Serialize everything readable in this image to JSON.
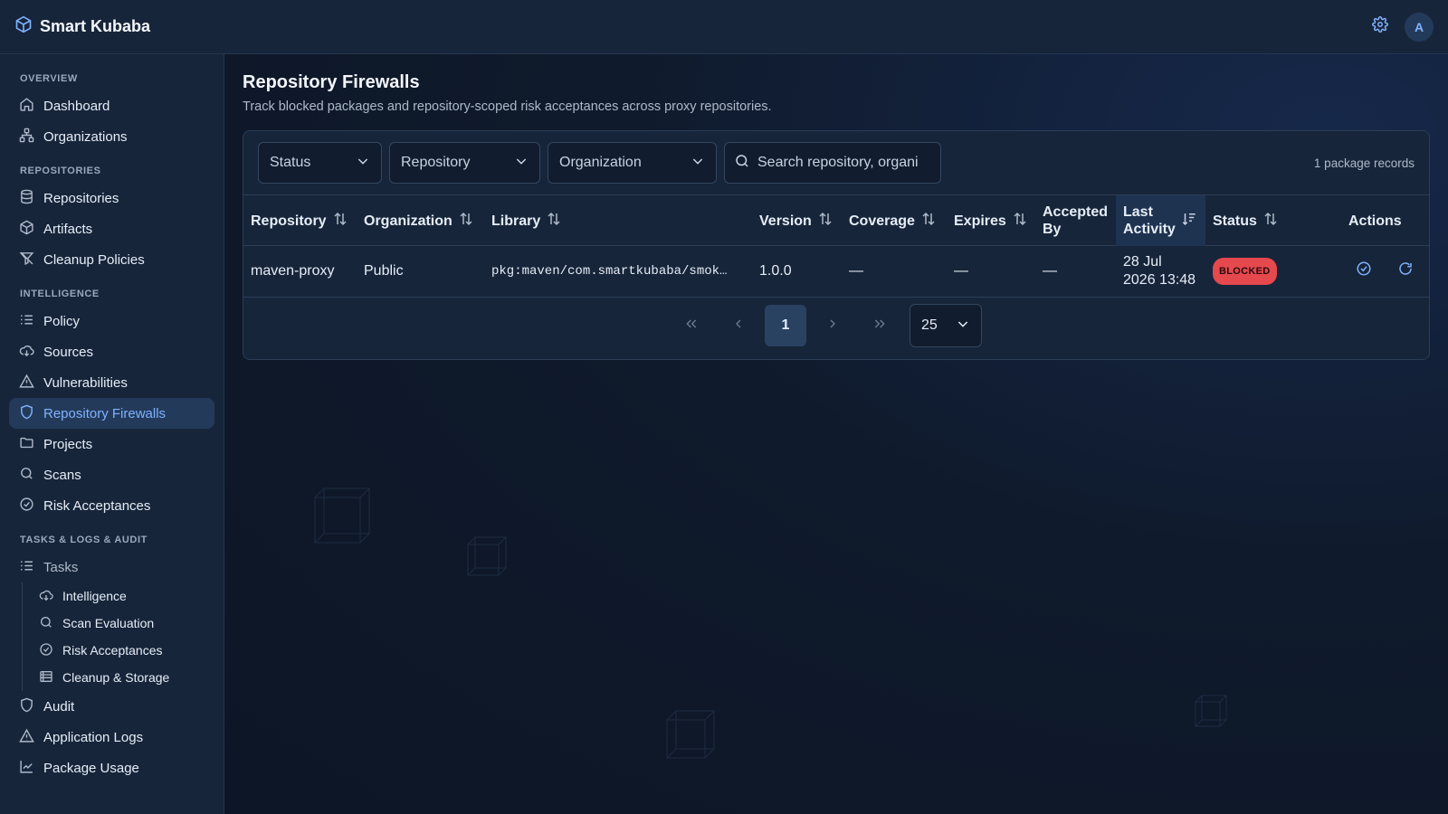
{
  "app": {
    "title": "Smart Kubaba",
    "avatar_initial": "A"
  },
  "colors": {
    "accent": "#7fb2ff",
    "blocked": "#e5484d",
    "background": "#0f1a2c",
    "panel": "#17253a"
  },
  "sidebar": {
    "sections": {
      "overview": "OVERVIEW",
      "repositories": "REPOSITORIES",
      "intelligence": "INTELLIGENCE",
      "tasks": "TASKS & LOGS & AUDIT"
    },
    "items": {
      "dashboard": "Dashboard",
      "organizations": "Organizations",
      "repositories": "Repositories",
      "artifacts": "Artifacts",
      "cleanup_policies": "Cleanup Policies",
      "policy": "Policy",
      "sources": "Sources",
      "vulnerabilities": "Vulnerabilities",
      "repository_firewalls": "Repository Firewalls",
      "projects": "Projects",
      "scans": "Scans",
      "risk_acceptances": "Risk Acceptances",
      "tasks": "Tasks",
      "audit": "Audit",
      "application_logs": "Application Logs",
      "package_usage": "Package Usage"
    },
    "task_subitems": {
      "intelligence": "Intelligence",
      "scan_evaluation": "Scan Evaluation",
      "risk_acceptances": "Risk Acceptances",
      "cleanup_storage": "Cleanup & Storage"
    }
  },
  "page": {
    "title": "Repository Firewalls",
    "subtitle": "Track blocked packages and repository-scoped risk acceptances across proxy repositories."
  },
  "filters": {
    "status": "Status",
    "repository": "Repository",
    "organization": "Organization",
    "search_placeholder": "Search repository, organi",
    "records": "1 package records"
  },
  "table": {
    "headers": {
      "repository": "Repository",
      "organization": "Organization",
      "library": "Library",
      "version": "Version",
      "coverage": "Coverage",
      "expires": "Expires",
      "accepted_by_line1": "Accepted",
      "accepted_by_line2": "By",
      "last_activity_line1": "Last",
      "last_activity_line2": "Activity",
      "status": "Status",
      "actions": "Actions"
    },
    "rows": [
      {
        "repository": "maven-proxy",
        "organization": "Public",
        "library": "pkg:maven/com.smartkubaba/smok…",
        "version": "1.0.0",
        "coverage": "—",
        "expires": "—",
        "accepted_by": "—",
        "last_activity_line1": "28 Jul",
        "last_activity_line2": "2026 13:48",
        "status": "BLOCKED"
      }
    ]
  },
  "pagination": {
    "current_page": "1",
    "per_page": "25"
  }
}
